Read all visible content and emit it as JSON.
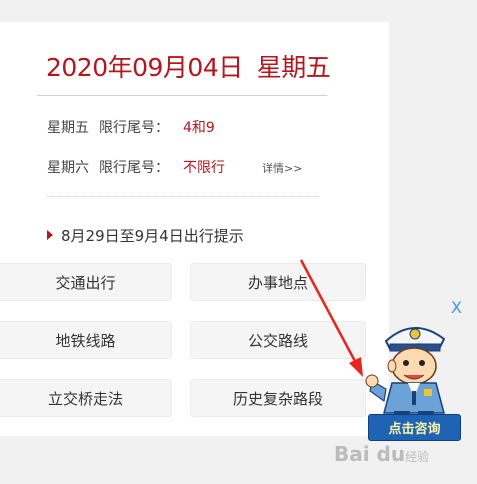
{
  "date": {
    "main": "2020年09月04日",
    "weekday": "星期五"
  },
  "restrictions": [
    {
      "day": "星期五",
      "label": "限行尾号：",
      "value": "4和9"
    },
    {
      "day": "星期六",
      "label": "限行尾号：",
      "value": "不限行"
    }
  ],
  "detail_link": "详情>>",
  "tip": "8月29日至9月4日出行提示",
  "buttons": [
    "交通出行",
    "办事地点",
    "地铁线路",
    "公交路线",
    "立交桥走法",
    "历史复杂路段"
  ],
  "close": "X",
  "consult_button": "点击咨询",
  "watermark": {
    "brand": "Bai du",
    "sub": "经验"
  },
  "colors": {
    "accent": "#b5161d",
    "annotation": "#e8261c",
    "consult": "#1f63b4"
  },
  "icons": [
    "triangle-bullet-icon",
    "police-mascot-icon",
    "close-icon"
  ]
}
